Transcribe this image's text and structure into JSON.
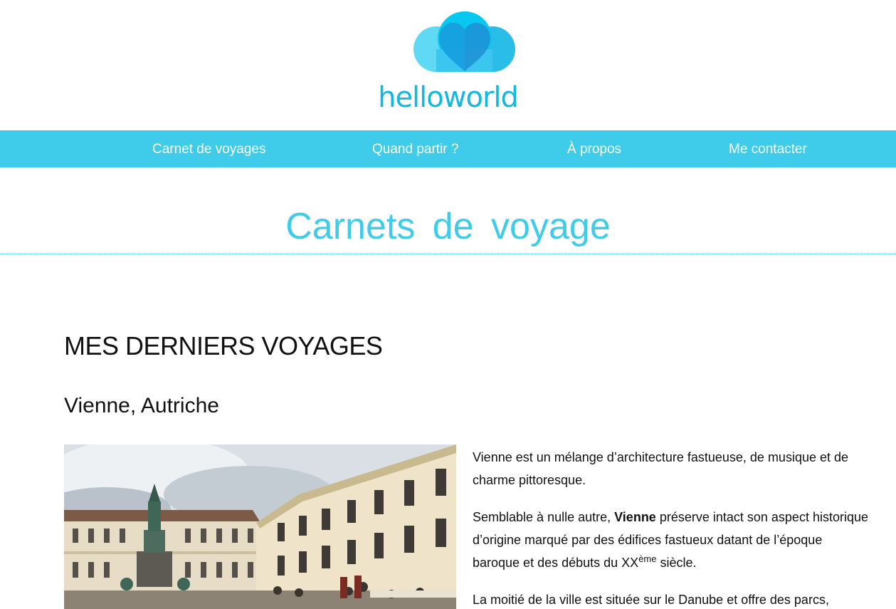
{
  "brand": {
    "logo_text": "helloworld",
    "colors": {
      "primary": "#3fcbea",
      "logo_dark": "#13b8e0",
      "logo_light": "#5fd9f4",
      "logo_heart": "#1f8fd6"
    }
  },
  "nav": {
    "items": [
      {
        "label": "Carnet de voyages"
      },
      {
        "label": "Quand partir ?"
      },
      {
        "label": "À propos"
      },
      {
        "label": "Me contacter"
      }
    ]
  },
  "page": {
    "title": "Carnets de voyage"
  },
  "main": {
    "section_heading": "MES DERNIERS VOYAGES",
    "trip": {
      "title": "Vienne, Autriche",
      "paragraphs": [
        {
          "text": "Vienne est un mélange d’architecture fastueuse, de musique et de charme pittoresque."
        },
        {
          "before": "Semblable à nulle autre, ",
          "bold": "Vienne",
          "after": " préserve intact son aspect historique d’origine marqué par des édifices fastueux datant de l’époque baroque et des débuts du XX",
          "sup": "ème",
          "end": " siècle."
        },
        {
          "text": "La moitié de la ville est située sur le Danube et offre des parcs,"
        }
      ]
    }
  }
}
